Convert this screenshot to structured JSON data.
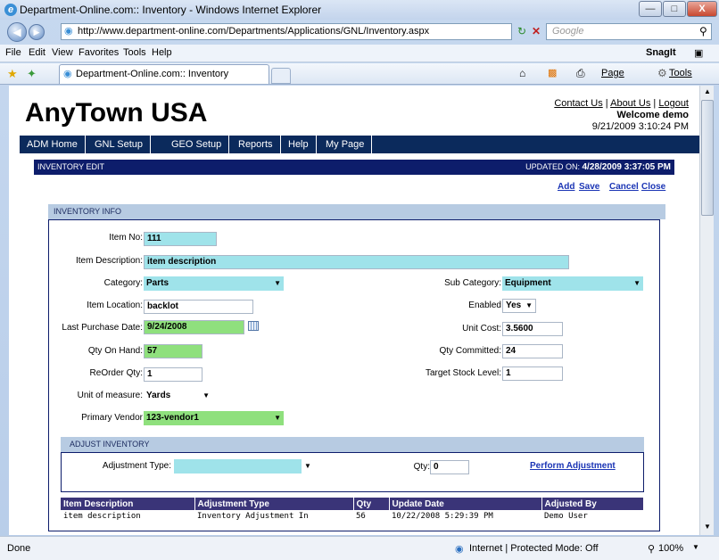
{
  "window": {
    "title": "Department-Online.com:: Inventory - Windows Internet Explorer",
    "url": "http://www.department-online.com/Departments/Applications/GNL/Inventory.aspx",
    "search_placeholder": "Google",
    "menu": [
      "File",
      "Edit",
      "View",
      "Favorites",
      "Tools",
      "Help"
    ],
    "snagit": "SnagIt",
    "tab_title": "Department-Online.com:: Inventory",
    "page_menu": "Page",
    "tools_menu": "Tools",
    "status": "Done",
    "zone": "Internet | Protected Mode: Off",
    "zoom": "100%"
  },
  "page": {
    "brand": "AnyTown USA",
    "contact_us": "Contact Us",
    "about_us": "About Us",
    "logout": "Logout",
    "separator": "|",
    "welcome": "Welcome demo",
    "datetime": "9/21/2009 3:10:24 PM",
    "nav": [
      "ADM Home",
      "GNL Setup",
      "GEO Setup",
      "Reports",
      "Help",
      "My Page"
    ],
    "edit_title": "INVENTORY EDIT",
    "updated_label": "UPDATED ON:",
    "updated_value": "4/28/2009 3:37:05 PM",
    "actions": {
      "add": "Add",
      "save": "Save",
      "cancel": "Cancel",
      "close": "Close"
    },
    "info_title": "INVENTORY INFO"
  },
  "form": {
    "item_no": {
      "label": "Item No:",
      "value": "111"
    },
    "item_description": {
      "label": "Item Description:",
      "value": "item description"
    },
    "category": {
      "label": "Category:",
      "value": "Parts"
    },
    "sub_category": {
      "label": "Sub Category:",
      "value": "Equipment"
    },
    "item_location": {
      "label": "Item Location:",
      "value": "backlot"
    },
    "enabled": {
      "label": "Enabled",
      "value": "Yes"
    },
    "last_purchase_date": {
      "label": "Last Purchase Date:",
      "value": "9/24/2008"
    },
    "unit_cost": {
      "label": "Unit Cost:",
      "value": "3.5600"
    },
    "qty_on_hand": {
      "label": "Qty On Hand:",
      "value": "57"
    },
    "qty_committed": {
      "label": "Qty Committed:",
      "value": "24"
    },
    "reorder_qty": {
      "label": "ReOrder Qty:",
      "value": "1"
    },
    "target_stock_level": {
      "label": "Target Stock Level:",
      "value": "1"
    },
    "unit_of_measure": {
      "label": "Unit of measure:",
      "value": "Yards"
    },
    "primary_vendor": {
      "label": "Primary Vendor",
      "value": "123-vendor1"
    }
  },
  "adjust": {
    "title": "ADJUST INVENTORY",
    "type_label": "Adjustment Type:",
    "type_value": "",
    "qty_label": "Qty:",
    "qty_value": "0",
    "perform": "Perform Adjustment"
  },
  "history": {
    "columns": [
      "Item Description",
      "Adjustment Type",
      "Qty",
      "Update Date",
      "Adjusted By"
    ],
    "rows": [
      [
        "item description",
        "Inventory Adjustment In",
        "56",
        "10/22/2008 5:29:39 PM",
        "Demo User"
      ]
    ]
  }
}
